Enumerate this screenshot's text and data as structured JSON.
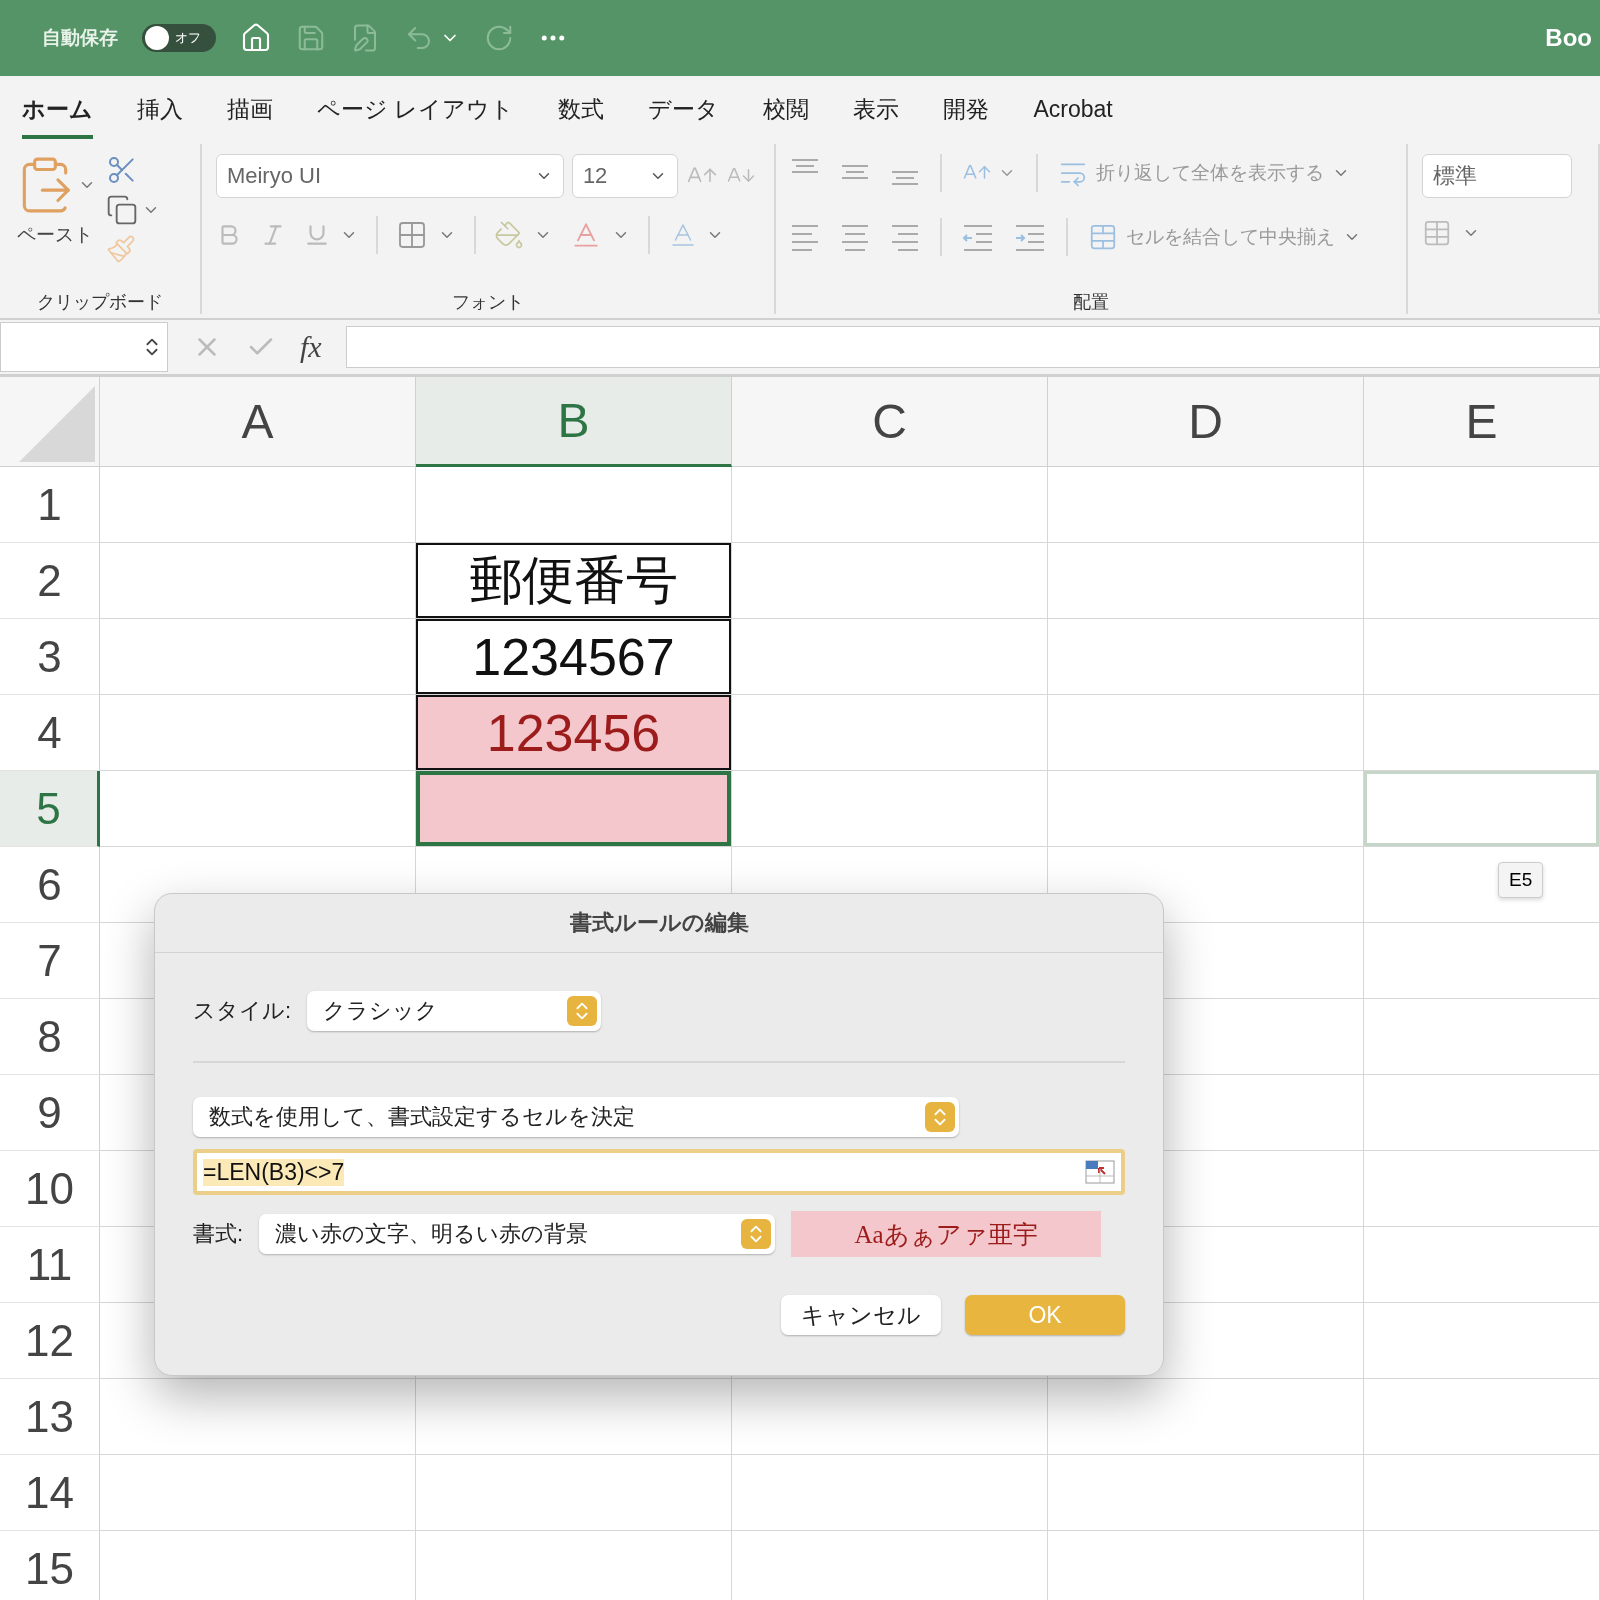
{
  "title_bar": {
    "autosave_label": "自動保存",
    "autosave": {
      "label": "オフ",
      "on": false
    },
    "workbook_title": "Boo"
  },
  "tabs": [
    {
      "label": "ホーム",
      "selected": true
    },
    {
      "label": "挿入",
      "selected": false
    },
    {
      "label": "描画",
      "selected": false
    },
    {
      "label": "ページ レイアウト",
      "selected": false
    },
    {
      "label": "数式",
      "selected": false
    },
    {
      "label": "データ",
      "selected": false
    },
    {
      "label": "校閲",
      "selected": false
    },
    {
      "label": "表示",
      "selected": false
    },
    {
      "label": "開発",
      "selected": false
    },
    {
      "label": "Acrobat",
      "selected": false
    }
  ],
  "ribbon": {
    "clipboard": {
      "paste_label": "ペースト",
      "group_label": "クリップボード"
    },
    "font": {
      "font_name": "Meiryo UI",
      "font_size": "12",
      "group_label": "フォント"
    },
    "alignment": {
      "wrap_text": "折り返して全体を表示する",
      "merge_center": "セルを結合して中央揃え",
      "group_label": "配置"
    },
    "number": {
      "format": "標準"
    }
  },
  "formula_bar": {
    "fx_label": "fx"
  },
  "sheet": {
    "columns": [
      {
        "label": "A",
        "selected": false
      },
      {
        "label": "B",
        "selected": true
      },
      {
        "label": "C",
        "selected": false
      },
      {
        "label": "D",
        "selected": false
      },
      {
        "label": "E",
        "selected": false
      }
    ],
    "rows": [
      {
        "label": "1",
        "selected": false,
        "cells": {}
      },
      {
        "label": "2",
        "selected": false,
        "cells": {
          "B": {
            "text": "郵便番号",
            "kind": "bordered"
          }
        }
      },
      {
        "label": "3",
        "selected": false,
        "cells": {
          "B": {
            "text": "1234567",
            "kind": "bordered"
          }
        }
      },
      {
        "label": "4",
        "selected": false,
        "cells": {
          "B": {
            "text": "123456",
            "kind": "highlight"
          }
        }
      },
      {
        "label": "5",
        "selected": true,
        "cells": {
          "B": {
            "kind": "highlight",
            "selected": true
          },
          "E": {
            "hovered": true
          }
        }
      },
      {
        "label": "6",
        "selected": false,
        "cells": {}
      },
      {
        "label": "7",
        "selected": false,
        "cells": {}
      },
      {
        "label": "8",
        "selected": false,
        "cells": {}
      },
      {
        "label": "9",
        "selected": false,
        "cells": {}
      },
      {
        "label": "10",
        "selected": false,
        "cells": {}
      },
      {
        "label": "11",
        "selected": false,
        "cells": {}
      },
      {
        "label": "12",
        "selected": false,
        "cells": {}
      },
      {
        "label": "13",
        "selected": false,
        "cells": {}
      },
      {
        "label": "14",
        "selected": false,
        "cells": {}
      },
      {
        "label": "15",
        "selected": false,
        "cells": {}
      }
    ],
    "cell_tooltip": "E5"
  },
  "dialog": {
    "title": "書式ルールの編集",
    "style_label": "スタイル:",
    "style_value": "クラシック",
    "rule_type": "数式を使用して、書式設定するセルを決定",
    "formula": {
      "value": "=LEN(B3)<>7",
      "text_selected": true
    },
    "format_label": "書式:",
    "format_value": "濃い赤の文字、明るい赤の背景",
    "preview": "Aaあぁアァ亜宇",
    "buttons": [
      {
        "label": "キャンセル",
        "kind": "secondary"
      },
      {
        "label": "OK",
        "kind": "default"
      }
    ]
  }
}
